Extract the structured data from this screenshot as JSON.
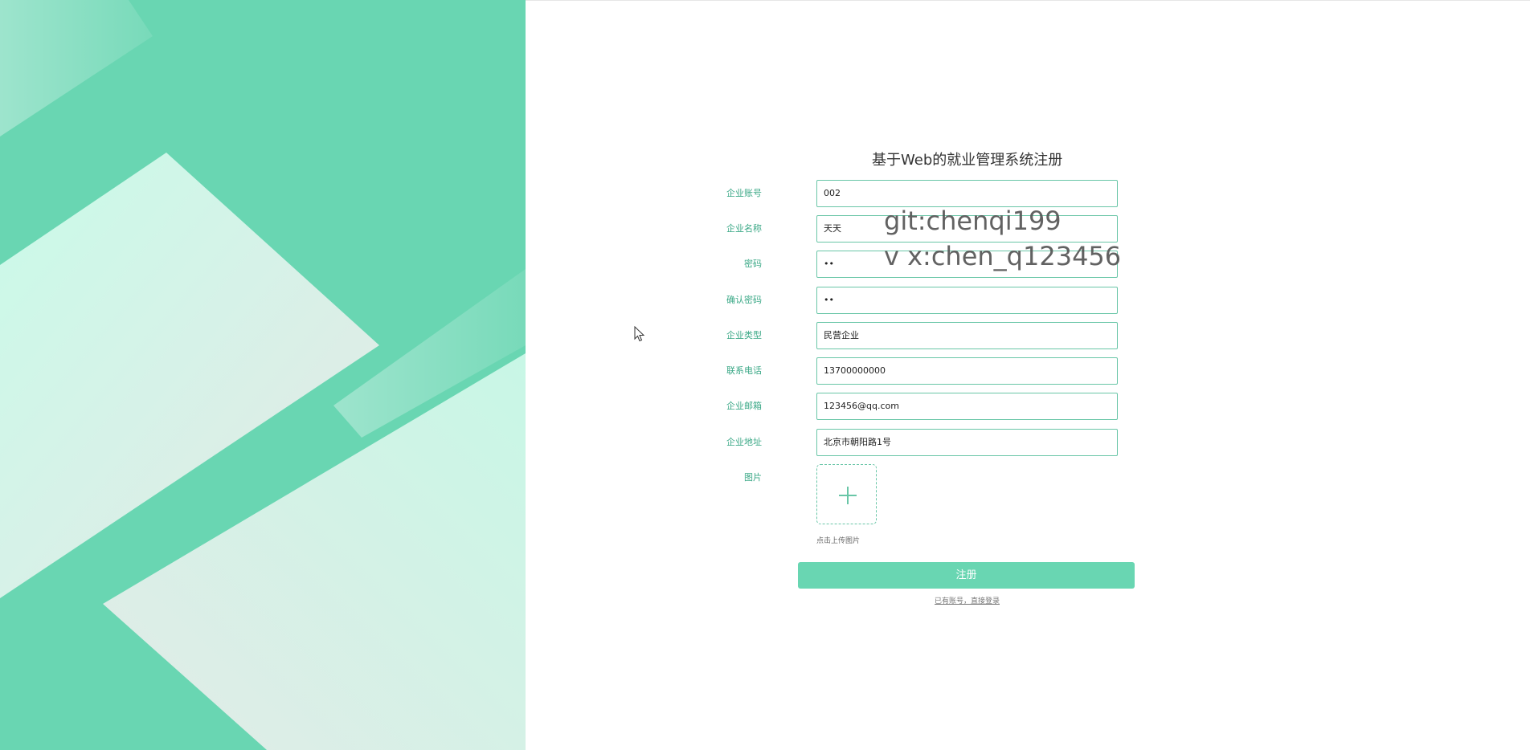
{
  "page": {
    "title": "基于Web的就业管理系统注册"
  },
  "form": {
    "fields": [
      {
        "label": "企业账号",
        "value": "002"
      },
      {
        "label": "企业名称",
        "value": "天天"
      },
      {
        "label": "密码",
        "value": "••"
      },
      {
        "label": "确认密码",
        "value": "••"
      },
      {
        "label": "企业类型",
        "value": "民营企业"
      },
      {
        "label": "联系电话",
        "value": "13700000000"
      },
      {
        "label": "企业邮箱",
        "value": "123456@qq.com"
      },
      {
        "label": "企业地址",
        "value": "北京市朝阳路1号"
      }
    ],
    "image_label": "图片",
    "upload_hint": "点击上传图片",
    "submit_label": "注册",
    "login_link": "已有账号，直接登录"
  },
  "watermark": {
    "line1": "git:chenqi199",
    "line2": "v x:chen_q123456"
  },
  "colors": {
    "accent": "#69d6b2",
    "border": "#69c6a7",
    "label": "#3aa886"
  },
  "icons": {
    "upload": "plus-icon",
    "cursor": "mouse-pointer-icon"
  }
}
